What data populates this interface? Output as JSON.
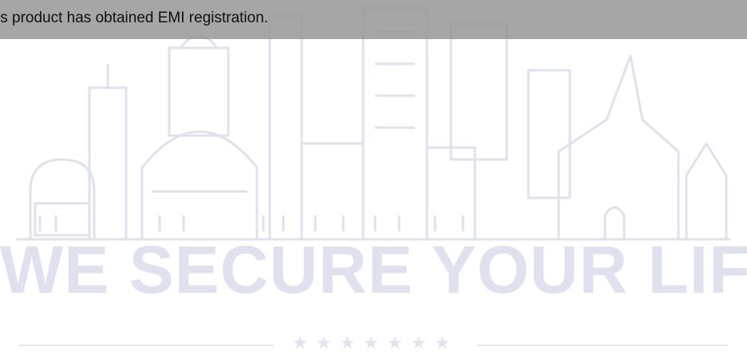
{
  "notice": {
    "text": "is product has obtained EMI registration."
  },
  "slogan": {
    "text": "WE SECURE YOUR LIFE"
  },
  "decoration": {
    "stars": "★★★★★★★",
    "illustration_icon": "city-skyline-icon"
  },
  "colors": {
    "notice_bar": "#969696",
    "watermark": "#dfe1ee"
  }
}
